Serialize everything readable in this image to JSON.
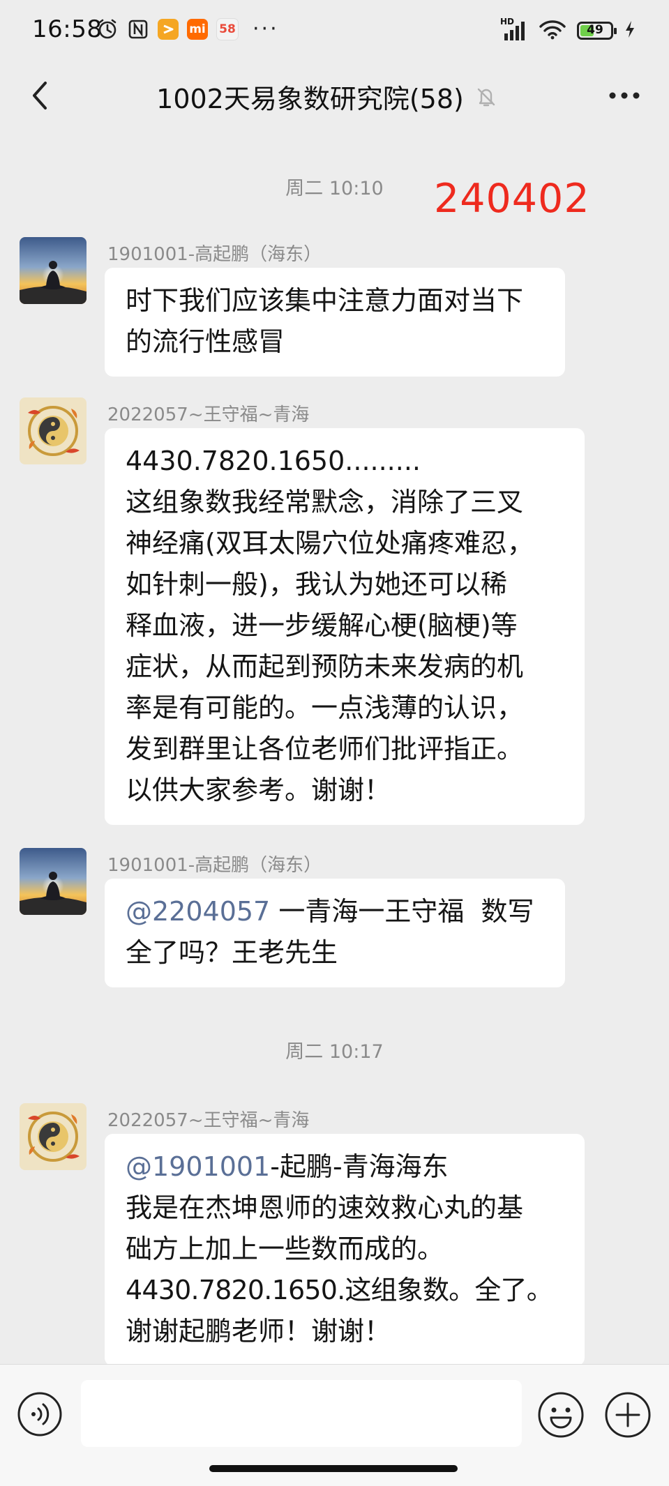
{
  "status_bar": {
    "time": "16:58",
    "badges": [
      {
        "icon": "yi-app-icon",
        "text": "",
        "color": "#f5a623"
      },
      {
        "icon": "mi-app-icon",
        "text": "mi",
        "color": "#ff6a00"
      },
      {
        "icon": "58-app-icon",
        "text": "58",
        "color": "#f3f3f3"
      }
    ],
    "more": "···",
    "network": "HD",
    "battery_level": "49",
    "battery_color": "#6fcf4a"
  },
  "header": {
    "title": "1002天易象数研究院(58)",
    "back_icon": "chevron-left-icon",
    "mute_icon": "bell-off-icon",
    "more_icon": "more-horizontal-icon"
  },
  "annotation": {
    "stamp": "240402",
    "color": "#ee2a1e"
  },
  "chat": {
    "time_separators": [
      "周二 10:10",
      "周二 10:17"
    ],
    "messages": [
      {
        "sender": "1901001-高起鹏（海东）",
        "avatar": "meditation-sunset-avatar",
        "lines": [
          "时下我们应该集中注意力面对当下",
          "的流行性感冒"
        ]
      },
      {
        "sender": "2022057~王守福~青海",
        "avatar": "koi-yin-yang-avatar",
        "lines": [
          "4430.7820.1650.........",
          "这组象数我经常默念，消除了三叉",
          "神经痛(双耳太陽穴位处痛疼难忍，",
          "如针刺一般)，我认为她还可以稀",
          "释血液，进一步缓解心梗(脑梗)等",
          "症状，从而起到预防未来发病的机",
          "率是有可能的。一点浅薄的认识，",
          "发到群里让各位老师们批评指正。",
          "以供大家参考。谢谢！"
        ]
      },
      {
        "sender": "1901001-高起鹏（海东）",
        "avatar": "meditation-sunset-avatar",
        "mention": "@2204057",
        "mention_rest": " 一青海一王守福  数写",
        "lines": [
          "全了吗？王老先生"
        ]
      },
      {
        "sender": "2022057~王守福~青海",
        "avatar": "koi-yin-yang-avatar",
        "mention": "@1901001",
        "mention_rest": "-起鹏-青海海东",
        "lines": [
          "我是在杰坤恩师的速效救心丸的基",
          "础方上加上一些数而成的。",
          "4430.7820.1650.这组象数。全了。",
          "谢谢起鹏老师！谢谢！"
        ]
      }
    ]
  },
  "input_bar": {
    "voice_icon": "voice-icon",
    "input_value": "",
    "emoji_icon": "emoji-icon",
    "plus_icon": "plus-circle-icon"
  }
}
